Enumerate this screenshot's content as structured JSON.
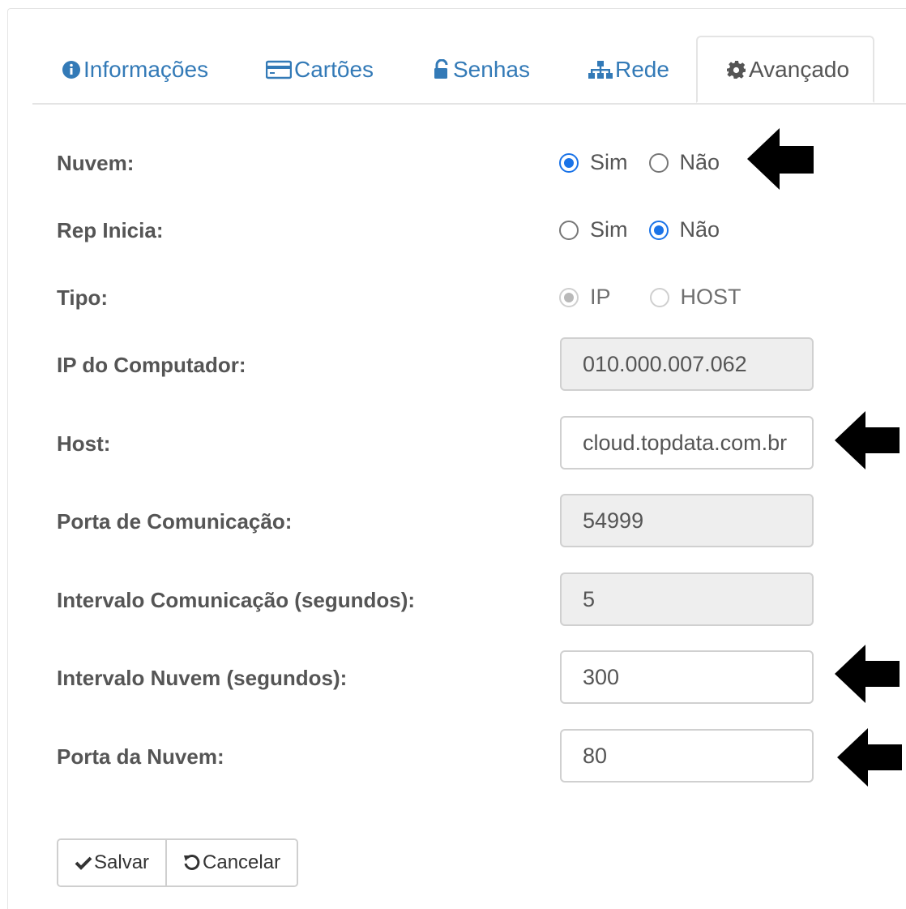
{
  "tabs": [
    {
      "label": "Informações",
      "icon": "info-circle-icon"
    },
    {
      "label": "Cartões",
      "icon": "credit-card-icon"
    },
    {
      "label": "Senhas",
      "icon": "unlock-icon"
    },
    {
      "label": "Rede",
      "icon": "sitemap-icon"
    },
    {
      "label": "Avançado",
      "icon": "gear-icon",
      "active": true
    }
  ],
  "form": {
    "nuvem": {
      "label": "Nuvem:",
      "options": [
        "Sim",
        "Não"
      ],
      "selected": "Sim"
    },
    "rep_inicia": {
      "label": "Rep Inicia:",
      "options": [
        "Sim",
        "Não"
      ],
      "selected": "Não"
    },
    "tipo": {
      "label": "Tipo:",
      "options": [
        "IP",
        "HOST"
      ],
      "selected": "IP",
      "disabled": true
    },
    "ip_computador": {
      "label": "IP do Computador:",
      "value": "010.000.007.062",
      "readonly": true
    },
    "host": {
      "label": "Host:",
      "value": "cloud.topdata.com.br"
    },
    "porta_comunicacao": {
      "label": "Porta de Comunicação:",
      "value": "54999",
      "readonly": true
    },
    "intervalo_comunicacao": {
      "label": "Intervalo Comunicação (segundos):",
      "value": "5",
      "readonly": true
    },
    "intervalo_nuvem": {
      "label": "Intervalo Nuvem (segundos):",
      "value": "300"
    },
    "porta_nuvem": {
      "label": "Porta da Nuvem:",
      "value": "80"
    }
  },
  "buttons": {
    "save": "Salvar",
    "cancel": "Cancelar"
  },
  "colors": {
    "link": "#337ab7",
    "radio_checked": "#1a73e8",
    "readonly_bg": "#eeeeee"
  }
}
